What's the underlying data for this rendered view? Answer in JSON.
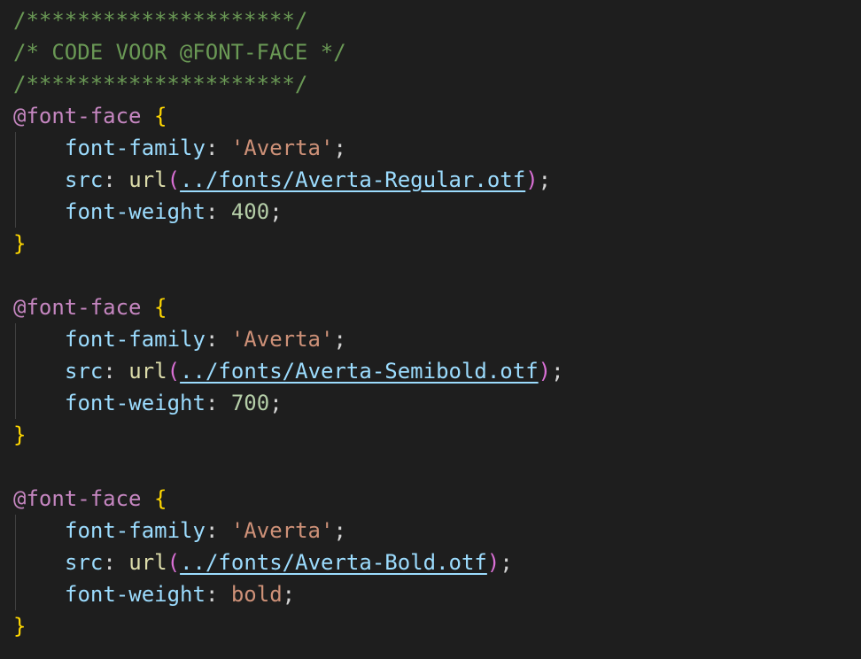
{
  "code": {
    "comment_border": "/*********************/",
    "comment_title": "/* CODE VOOR @FONT-FACE */",
    "at_rule": "@font-face",
    "open_brace": "{",
    "close_brace": "}",
    "prop_family": "font-family",
    "prop_src": "src",
    "prop_weight": "font-weight",
    "colon": ":",
    "semicolon": ";",
    "url_func": "url",
    "paren_open": "(",
    "paren_close": ")",
    "blocks": [
      {
        "family": "'Averta'",
        "src": "../fonts/Averta-Regular.otf",
        "weight": "400"
      },
      {
        "family": "'Averta'",
        "src": "../fonts/Averta-Semibold.otf",
        "weight": "700"
      },
      {
        "family": "'Averta'",
        "src": "../fonts/Averta-Bold.otf",
        "weight": "bold"
      }
    ]
  },
  "colors": {
    "background": "#1e1e1e",
    "comment": "#6a9955",
    "at_rule": "#c586c0",
    "brace": "#ffd700",
    "property": "#9cdcfe",
    "string": "#ce9178",
    "number": "#b5cea8",
    "function": "#dcdcaa"
  }
}
